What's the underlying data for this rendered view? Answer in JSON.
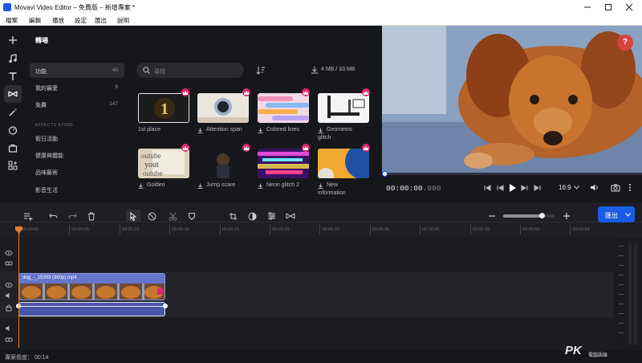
{
  "window": {
    "title": "Movavi Video Editor – 免費版 – 新增專案 *"
  },
  "menu": [
    "檔案",
    "編輯",
    "播放",
    "設定",
    "匯出",
    "說明"
  ],
  "panel": {
    "title": "轉場",
    "search_placeholder": "尋找",
    "storage": "4 MB / 33 MB"
  },
  "categories": [
    {
      "label": "功能",
      "count": "40"
    },
    {
      "label": "我的最愛",
      "count": "6"
    },
    {
      "label": "免費",
      "count": "147"
    }
  ],
  "store_heading": "EFFECTS STORE",
  "store_items": [
    "假日活動",
    "健康與體能",
    "品味藝術",
    "影音生活"
  ],
  "transitions": [
    {
      "label": "1st place",
      "dl": false
    },
    {
      "label": "Attention span",
      "dl": true
    },
    {
      "label": "Colored lines",
      "dl": true
    },
    {
      "label": "Geometric",
      "label2": "glitch",
      "dl": true
    },
    {
      "label": "Golden",
      "dl": true
    },
    {
      "label": "Jump scare",
      "dl": true
    },
    {
      "label": "Neon glitch 2",
      "dl": true
    },
    {
      "label": "New",
      "label2": "information",
      "dl": true
    }
  ],
  "preview": {
    "timecode": "00:00:00",
    "timecode_ms": ".000",
    "aspect": "16:9",
    "help": "?",
    "progress": 0
  },
  "toolbar": {
    "export_label": "匯出",
    "zoom_level": 0.75
  },
  "ruler": [
    "00:00:00",
    "00:00:05",
    "00:00:10",
    "00:00:15",
    "00:00:20",
    "00:00:25",
    "00:00:30",
    "00:00:35",
    "00:00:40",
    "00:00:45",
    "00:00:50",
    "00:00:55"
  ],
  "clip": {
    "name": "dog_-_15303 (360p).mp4"
  },
  "status": {
    "project_length": "專案長度： 00:14"
  },
  "watermark": {
    "big": "PK",
    "small": "電腦語錄"
  },
  "colors": {
    "accent": "#1a5ce6",
    "clip": "#6575c9",
    "audio": "#4a56a8",
    "playhead": "#e8782a",
    "crown": "#e0286d"
  }
}
